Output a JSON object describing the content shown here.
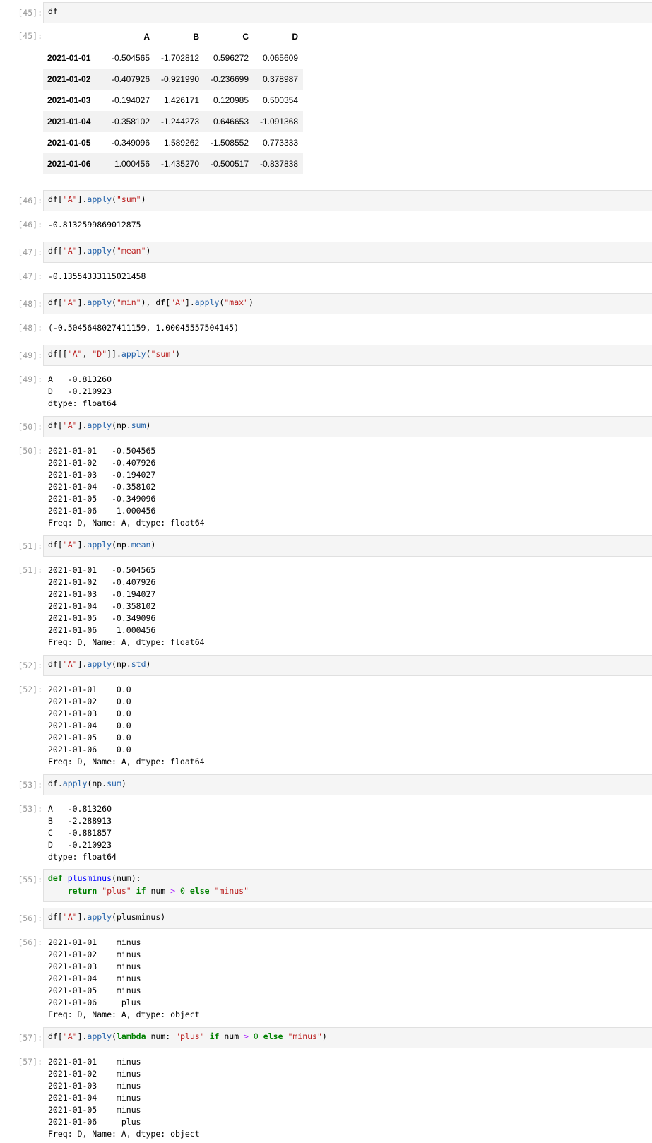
{
  "cells": {
    "c45": {
      "in_prompt": "[45]:",
      "out_prompt": "[45]:",
      "code": [
        "df"
      ],
      "table": {
        "columns": [
          "A",
          "B",
          "C",
          "D"
        ],
        "rows": [
          {
            "index": "2021-01-01",
            "values": [
              "-0.504565",
              "-1.702812",
              "0.596272",
              "0.065609"
            ]
          },
          {
            "index": "2021-01-02",
            "values": [
              "-0.407926",
              "-0.921990",
              "-0.236699",
              "0.378987"
            ]
          },
          {
            "index": "2021-01-03",
            "values": [
              "-0.194027",
              "1.426171",
              "0.120985",
              "0.500354"
            ]
          },
          {
            "index": "2021-01-04",
            "values": [
              "-0.358102",
              "-1.244273",
              "0.646653",
              "-1.091368"
            ]
          },
          {
            "index": "2021-01-05",
            "values": [
              "-0.349096",
              "1.589262",
              "-1.508552",
              "0.773333"
            ]
          },
          {
            "index": "2021-01-06",
            "values": [
              "1.000456",
              "-1.435270",
              "-0.500517",
              "-0.837838"
            ]
          }
        ]
      }
    },
    "c46": {
      "in_prompt": "[46]:",
      "out_prompt": "[46]:",
      "code": [
        "df[",
        "\"A\"",
        "].",
        "apply",
        "(",
        "\"sum\"",
        ")"
      ],
      "output": "-0.8132599869012875"
    },
    "c47": {
      "in_prompt": "[47]:",
      "out_prompt": "[47]:",
      "code": [
        "df[",
        "\"A\"",
        "].",
        "apply",
        "(",
        "\"mean\"",
        ")"
      ],
      "output": "-0.13554333115021458"
    },
    "c48": {
      "in_prompt": "[48]:",
      "out_prompt": "[48]:",
      "code": [
        "df[",
        "\"A\"",
        "].",
        "apply",
        "(",
        "\"min\"",
        "), df[",
        "\"A\"",
        "].",
        "apply",
        "(",
        "\"max\"",
        ")"
      ],
      "output": "(-0.5045648027411159, 1.00045557504145)"
    },
    "c49": {
      "in_prompt": "[49]:",
      "out_prompt": "[49]:",
      "code": [
        "df[[",
        "\"A\"",
        ", ",
        "\"D\"",
        "]].",
        "apply",
        "(",
        "\"sum\"",
        ")"
      ],
      "output": "A   -0.813260\nD   -0.210923\ndtype: float64"
    },
    "c50": {
      "in_prompt": "[50]:",
      "out_prompt": "[50]:",
      "code": [
        "df[",
        "\"A\"",
        "].",
        "apply",
        "(np.",
        "sum",
        ")"
      ],
      "output": "2021-01-01   -0.504565\n2021-01-02   -0.407926\n2021-01-03   -0.194027\n2021-01-04   -0.358102\n2021-01-05   -0.349096\n2021-01-06    1.000456\nFreq: D, Name: A, dtype: float64"
    },
    "c51": {
      "in_prompt": "[51]:",
      "out_prompt": "[51]:",
      "code": [
        "df[",
        "\"A\"",
        "].",
        "apply",
        "(np.",
        "mean",
        ")"
      ],
      "output": "2021-01-01   -0.504565\n2021-01-02   -0.407926\n2021-01-03   -0.194027\n2021-01-04   -0.358102\n2021-01-05   -0.349096\n2021-01-06    1.000456\nFreq: D, Name: A, dtype: float64"
    },
    "c52": {
      "in_prompt": "[52]:",
      "out_prompt": "[52]:",
      "code": [
        "df[",
        "\"A\"",
        "].",
        "apply",
        "(np.",
        "std",
        ")"
      ],
      "output": "2021-01-01    0.0\n2021-01-02    0.0\n2021-01-03    0.0\n2021-01-04    0.0\n2021-01-05    0.0\n2021-01-06    0.0\nFreq: D, Name: A, dtype: float64"
    },
    "c53": {
      "in_prompt": "[53]:",
      "out_prompt": "[53]:",
      "code": [
        "df.",
        "apply",
        "(np.",
        "sum",
        ")"
      ],
      "output": "A   -0.813260\nB   -2.288913\nC   -0.881857\nD   -0.210923\ndtype: float64"
    },
    "c55": {
      "in_prompt": "[55]:",
      "line1": [
        "def",
        " ",
        "plusminus",
        "(num):"
      ],
      "line2": [
        "    ",
        "return",
        " ",
        "\"plus\"",
        " ",
        "if",
        " num ",
        ">",
        " ",
        "0",
        " ",
        "else",
        " ",
        "\"minus\""
      ]
    },
    "c56": {
      "in_prompt": "[56]:",
      "out_prompt": "[56]:",
      "code": [
        "df[",
        "\"A\"",
        "].",
        "apply",
        "(plusminus)"
      ],
      "output": "2021-01-01    minus\n2021-01-02    minus\n2021-01-03    minus\n2021-01-04    minus\n2021-01-05    minus\n2021-01-06     plus\nFreq: D, Name: A, dtype: object"
    },
    "c57": {
      "in_prompt": "[57]:",
      "out_prompt": "[57]:",
      "code": [
        "df[",
        "\"A\"",
        "].",
        "apply",
        "(",
        "lambda",
        " num: ",
        "\"plus\"",
        " ",
        "if",
        " num ",
        ">",
        " ",
        "0",
        " ",
        "else",
        " ",
        "\"minus\"",
        ")"
      ],
      "output": "2021-01-01    minus\n2021-01-02    minus\n2021-01-03    minus\n2021-01-04    minus\n2021-01-05    minus\n2021-01-06     plus\nFreq: D, Name: A, dtype: object"
    }
  }
}
